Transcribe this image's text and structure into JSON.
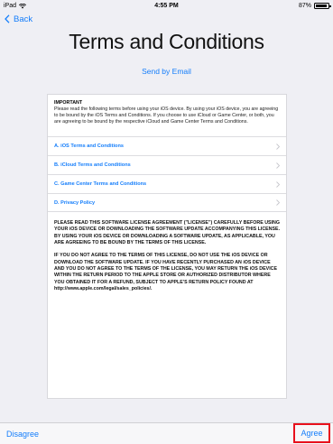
{
  "status_bar": {
    "carrier": "iPad",
    "time": "4:55 PM",
    "battery": "87%"
  },
  "nav": {
    "back_label": "Back"
  },
  "page_title": "Terms and Conditions",
  "send_email_label": "Send by Email",
  "important": {
    "heading": "IMPORTANT",
    "text": "Please read the following terms before using your iOS device. By using your iOS device, you are agreeing to be bound by the iOS Terms and Conditions. If you choose to use iCloud or Game Center, or both, you are agreeing to be bound by the respective iCloud and Game Center Terms and Conditions."
  },
  "links": [
    {
      "label": "A. iOS Terms and Conditions"
    },
    {
      "label": "B. iCloud Terms and Conditions"
    },
    {
      "label": "C. Game Center Terms and Conditions"
    },
    {
      "label": "D. Privacy Policy"
    }
  ],
  "legal": {
    "paragraph1": "PLEASE READ THIS SOFTWARE LICENSE AGREEMENT (\"LICENSE\") CAREFULLY BEFORE USING YOUR iOS DEVICE OR DOWNLOADING THE SOFTWARE UPDATE ACCOMPANYING THIS LICENSE. BY USING YOUR iOS DEVICE OR DOWNLOADING A SOFTWARE UPDATE, AS APPLICABLE, YOU ARE AGREEING TO BE BOUND BY THE TERMS OF THIS LICENSE.",
    "paragraph2": "IF YOU DO NOT AGREE TO THE TERMS OF THIS LICENSE, DO NOT USE THE iOS DEVICE OR DOWNLOAD THE SOFTWARE UPDATE. IF YOU HAVE RECENTLY PURCHASED AN iOS DEVICE AND YOU DO NOT AGREE TO THE TERMS OF THE LICENSE, YOU MAY RETURN THE iOS DEVICE WITHIN THE RETURN PERIOD TO THE APPLE STORE OR AUTHORIZED DISTRIBUTOR WHERE YOU OBTAINED IT FOR A REFUND, SUBJECT TO APPLE'S RETURN POLICY FOUND AT http://www.apple.com/legal/sales_policies/."
  },
  "bottom_bar": {
    "disagree_label": "Disagree",
    "agree_label": "Agree"
  },
  "colors": {
    "accent": "#157efb",
    "highlight": "#e8101c",
    "background": "#efeff4"
  }
}
